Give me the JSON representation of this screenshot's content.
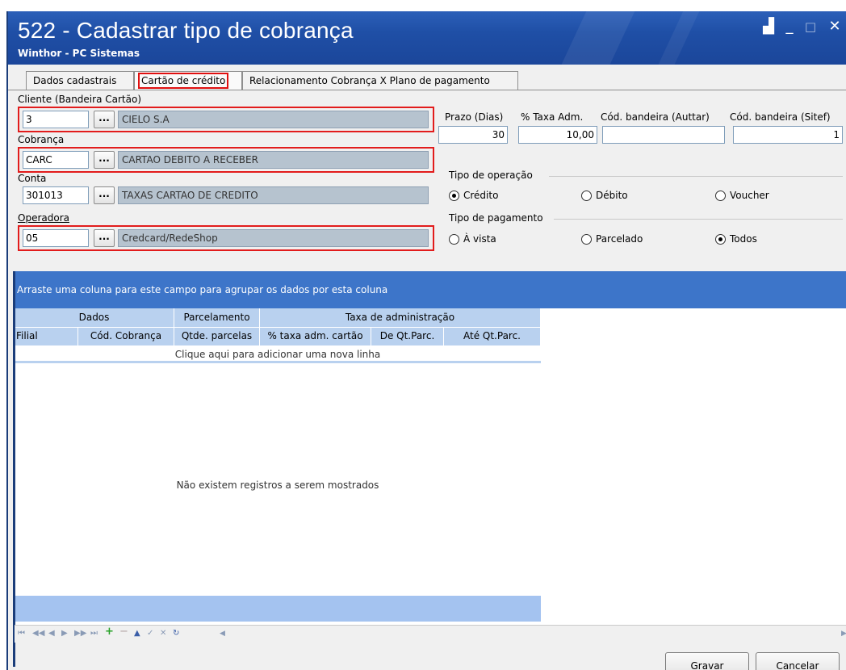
{
  "window": {
    "title": "522 - Cadastrar tipo de cobrança",
    "subtitle": "Winthor - PC Sistemas",
    "controls": {
      "restore": "▟",
      "minimize": "_",
      "maximize": "□",
      "close": "✕"
    }
  },
  "tabs": [
    {
      "label": "Dados cadastrais"
    },
    {
      "label": "Cartão de crédito",
      "active": true
    },
    {
      "label": "Relacionamento Cobrança X Plano de pagamento"
    }
  ],
  "form": {
    "cliente": {
      "label": "Cliente (Bandeira Cartão)",
      "code": "3",
      "button": "...",
      "description": "CIELO S.A"
    },
    "cobranca": {
      "label": "Cobrança",
      "code": "CARC",
      "button": "...",
      "description": "CARTAO DEBITO A RECEBER"
    },
    "conta": {
      "label": "Conta",
      "code": "301013",
      "button": "...",
      "description": "TAXAS CARTAO DE CREDITO"
    },
    "operadora": {
      "label": "Operadora",
      "code": "05",
      "button": "...",
      "description": "Credcard/RedeShop"
    },
    "prazo": {
      "label": "Prazo (Dias)",
      "value": "30"
    },
    "taxa": {
      "label": "% Taxa Adm.",
      "value": "10,00"
    },
    "bandeira_auttar": {
      "label": "Cód. bandeira (Auttar)",
      "value": ""
    },
    "bandeira_sitef": {
      "label": "Cód. bandeira (Sitef)",
      "value": "1"
    },
    "tipo_operacao": {
      "title": "Tipo de operação",
      "options": [
        {
          "label": "Crédito",
          "selected": true
        },
        {
          "label": "Débito",
          "selected": false
        },
        {
          "label": "Voucher",
          "selected": false
        }
      ]
    },
    "tipo_pagamento": {
      "title": "Tipo de pagamento",
      "options": [
        {
          "label": "À vista",
          "selected": false
        },
        {
          "label": "Parcelado",
          "selected": false
        },
        {
          "label": "Todos",
          "selected": true
        }
      ]
    }
  },
  "grid": {
    "group_hint": "Arraste uma coluna para este campo para agrupar os dados por esta coluna",
    "bands": [
      "Dados",
      "Parcelamento",
      "Taxa de administração"
    ],
    "columns": [
      "Filial",
      "Cód. Cobrança",
      "Qtde. parcelas",
      "% taxa adm. cartão",
      "De Qt.Parc.",
      "Até Qt.Parc."
    ],
    "new_row": "Clique aqui para adicionar uma nova linha",
    "empty": "Não existem registros a serem mostrados"
  },
  "navigator": [
    "⏮",
    "◀◀",
    "◀",
    "▶",
    "▶▶",
    "⏭",
    "+",
    "−",
    "▲",
    "✓",
    "✕",
    "↻",
    "◀",
    "▶"
  ],
  "buttons": {
    "save": "Gravar",
    "cancel": "Cancelar"
  },
  "colors": {
    "titlebar": "#1f4fa6",
    "highlight": "#e21c1c",
    "grid_header": "#b9d1ef",
    "group_bar": "#3d75c9"
  }
}
